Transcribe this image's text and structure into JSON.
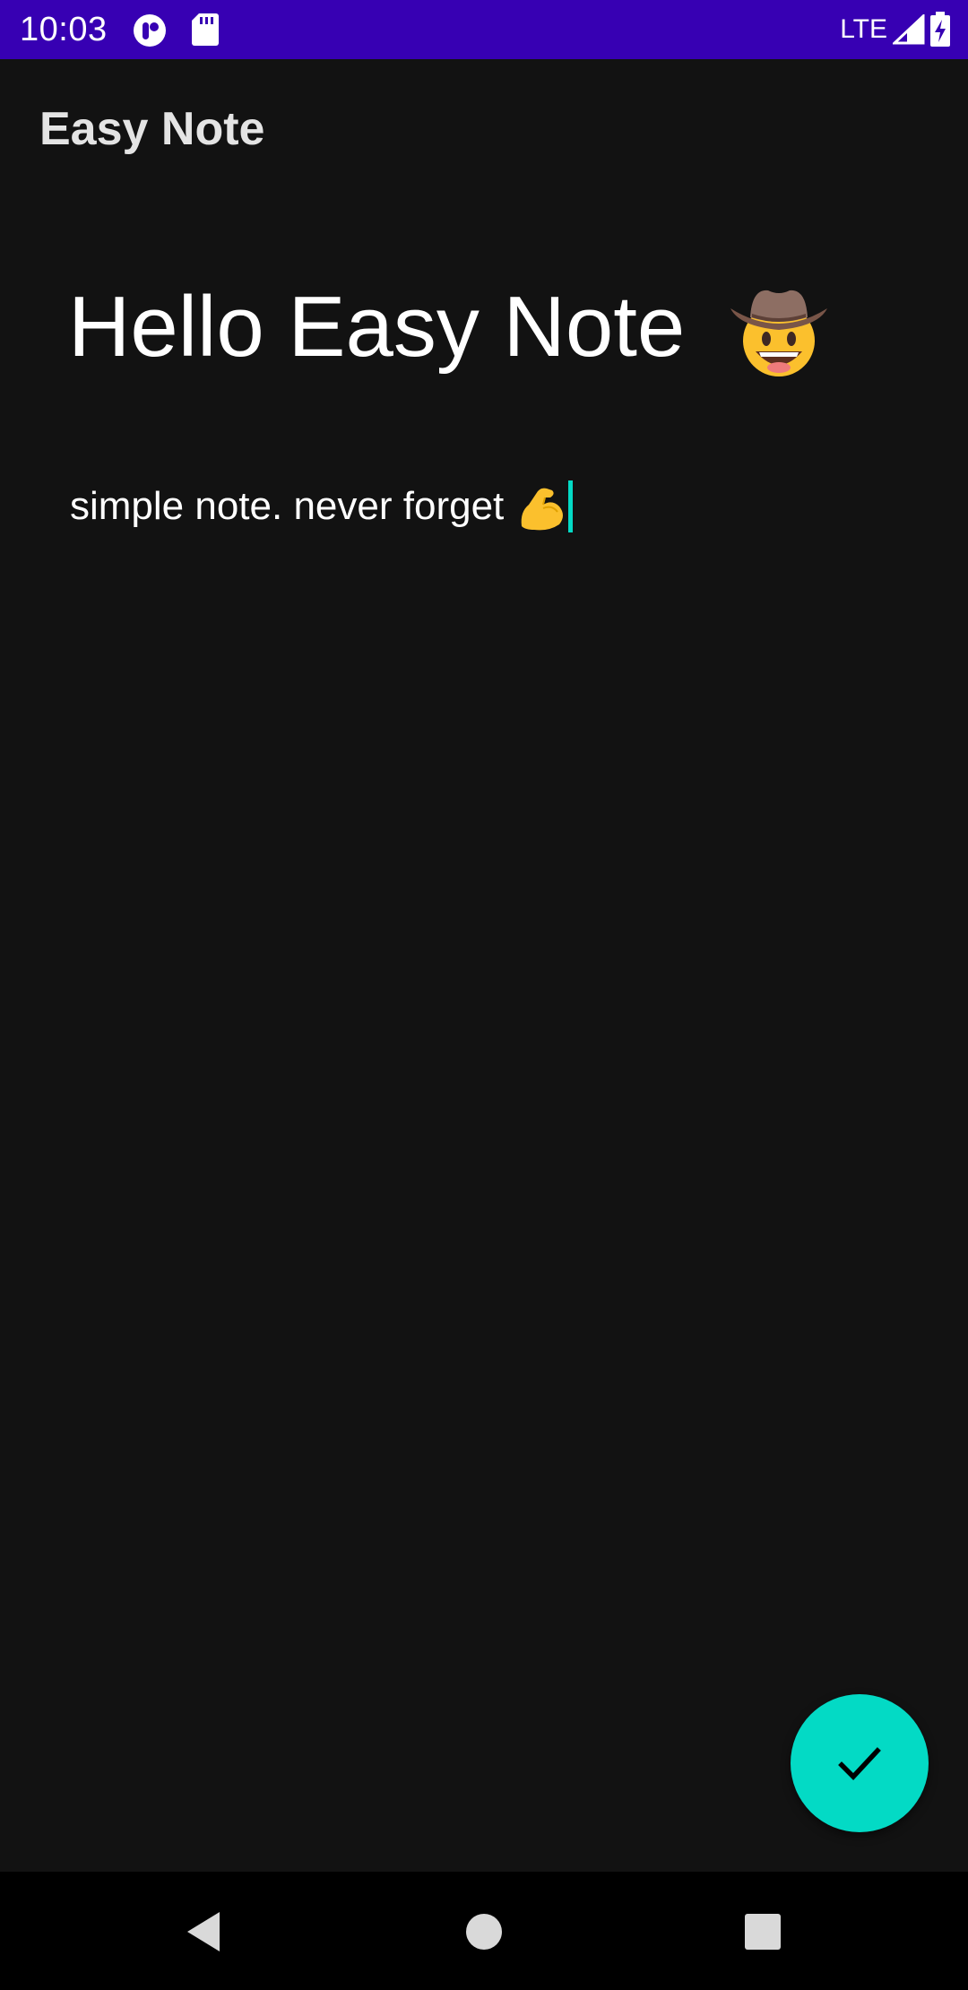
{
  "status_bar": {
    "time": "10:03",
    "network_label": "LTE",
    "background_color": "#3700b3",
    "icons": [
      "notification-app-icon",
      "sd-card-icon",
      "signal-icon",
      "battery-charging-icon"
    ]
  },
  "app_bar": {
    "title": "Easy Note"
  },
  "note": {
    "title": "Hello Easy Note",
    "title_emoji": "cowboy-hat-face",
    "body": "simple note. never forget",
    "body_emoji": "flexed-biceps"
  },
  "fab": {
    "icon": "check-icon",
    "color": "#03dac5"
  },
  "nav_bar": {
    "buttons": [
      "back-icon",
      "home-icon",
      "recents-icon"
    ]
  },
  "theme": {
    "background": "#121212",
    "accent": "#03dac5"
  }
}
